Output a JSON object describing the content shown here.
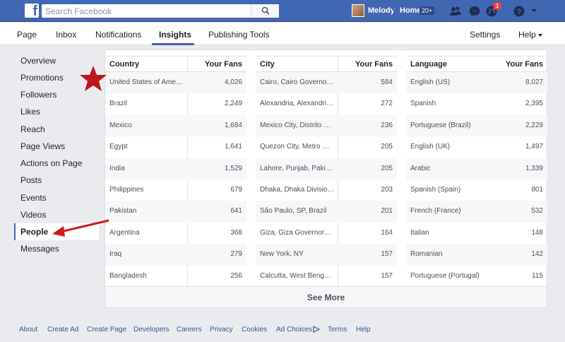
{
  "topbar": {
    "search_placeholder": "Search Facebook",
    "user_name": "Melody",
    "home_label": "Home",
    "home_badge": "20+",
    "notifications_count": "1"
  },
  "pagenav": {
    "items": [
      "Page",
      "Inbox",
      "Notifications",
      "Insights",
      "Publishing Tools"
    ],
    "active": "Insights",
    "settings": "Settings",
    "help": "Help"
  },
  "sidebar": {
    "items": [
      "Overview",
      "Promotions",
      "Followers",
      "Likes",
      "Reach",
      "Page Views",
      "Actions on Page",
      "Posts",
      "Events",
      "Videos",
      "People",
      "Messages"
    ],
    "active": "People"
  },
  "country_table": {
    "headers": [
      "Country",
      "Your Fans"
    ],
    "rows": [
      [
        "United States of America",
        "4,026"
      ],
      [
        "Brazil",
        "2,249"
      ],
      [
        "Mexico",
        "1,684"
      ],
      [
        "Egypt",
        "1,641"
      ],
      [
        "India",
        "1,529"
      ],
      [
        "Philippines",
        "679"
      ],
      [
        "Pakistan",
        "641"
      ],
      [
        "Argentina",
        "368"
      ],
      [
        "Iraq",
        "279"
      ],
      [
        "Bangladesh",
        "256"
      ]
    ]
  },
  "city_table": {
    "headers": [
      "City",
      "Your Fans"
    ],
    "rows": [
      [
        "Cairo, Cairo Governora...",
        "584"
      ],
      [
        "Alexandria, Alexandria ...",
        "272"
      ],
      [
        "Mexico City, Distrito Fe...",
        "236"
      ],
      [
        "Quezon City, Metro Ma...",
        "205"
      ],
      [
        "Lahore, Punjab, Pakistan",
        "205"
      ],
      [
        "Dhaka, Dhaka Division,...",
        "203"
      ],
      [
        "São Paulo, SP, Brazil",
        "201"
      ],
      [
        "Giza, Giza Governorat...",
        "164"
      ],
      [
        "New York, NY",
        "157"
      ],
      [
        "Calcutta, West Bengal,...",
        "157"
      ]
    ]
  },
  "language_table": {
    "headers": [
      "Language",
      "Your Fans"
    ],
    "rows": [
      [
        "English (US)",
        "8,027"
      ],
      [
        "Spanish",
        "2,395"
      ],
      [
        "Portuguese (Brazil)",
        "2,229"
      ],
      [
        "English (UK)",
        "1,497"
      ],
      [
        "Arabic",
        "1,339"
      ],
      [
        "Spanish (Spain)",
        "801"
      ],
      [
        "French (France)",
        "532"
      ],
      [
        "Italian",
        "148"
      ],
      [
        "Romanian",
        "142"
      ],
      [
        "Portuguese (Portugal)",
        "115"
      ]
    ]
  },
  "see_more": "See More",
  "footer": {
    "links": [
      "About",
      "Create Ad",
      "Create Page",
      "Developers",
      "Careers",
      "Privacy",
      "Cookies",
      "Ad Choices",
      "Terms",
      "Help"
    ]
  },
  "colors": {
    "brand": "#4267b2",
    "annotation": "#c0141c",
    "link": "#365899"
  }
}
